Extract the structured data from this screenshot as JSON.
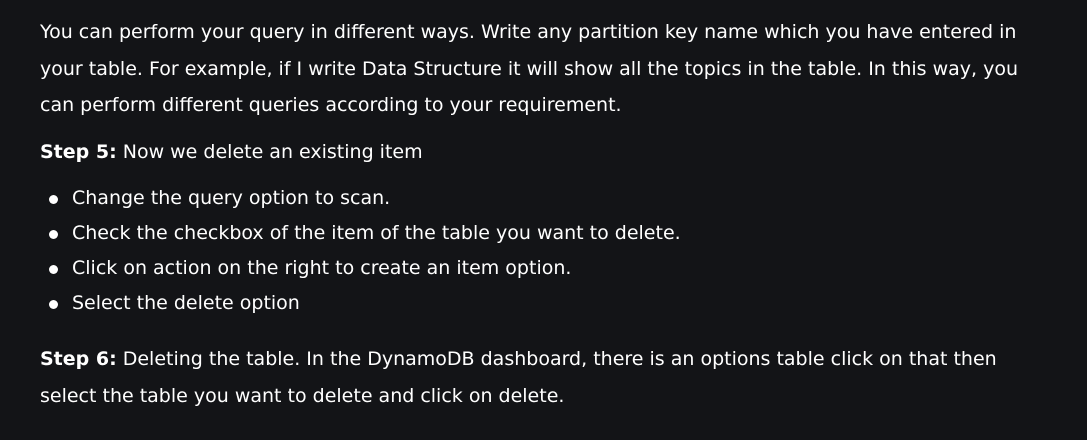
{
  "intro": {
    "text": "You can perform your query in different ways. Write any partition key name which you have entered in your table. For example, if I write Data Structure it will show all the topics in the table. In this way, you can perform different queries according to your requirement."
  },
  "step5": {
    "label": "Step 5:",
    "text": " Now we delete an existing item",
    "bullets": [
      "Change the query option to scan.",
      "Check the checkbox of the item of the table you want to delete.",
      "Click on action on the right to create an item option.",
      "Select the delete option"
    ]
  },
  "step6": {
    "label": "Step 6:",
    "text": " Deleting the table. In the DynamoDB dashboard, there is an options table click on that then select the table you want to delete and click on delete."
  }
}
